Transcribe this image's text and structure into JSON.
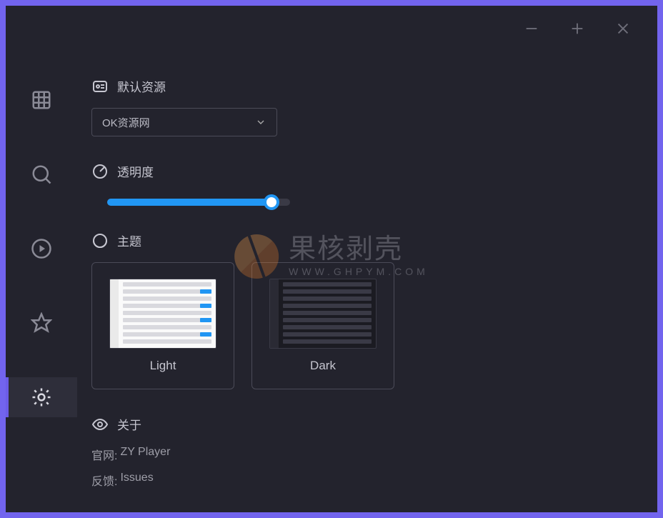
{
  "settings": {
    "default_source": {
      "title": "默认资源",
      "selected": "OK资源网"
    },
    "opacity": {
      "title": "透明度",
      "value_percent": 90
    },
    "theme": {
      "title": "主题",
      "options": {
        "light": "Light",
        "dark": "Dark"
      }
    },
    "about": {
      "title": "关于",
      "website": {
        "label": "官网:",
        "value": "ZY Player"
      },
      "feedback": {
        "label": "反馈:",
        "value": "Issues"
      }
    }
  },
  "watermark": {
    "main": "果核剥壳",
    "sub": "WWW.GHPYM.COM"
  }
}
